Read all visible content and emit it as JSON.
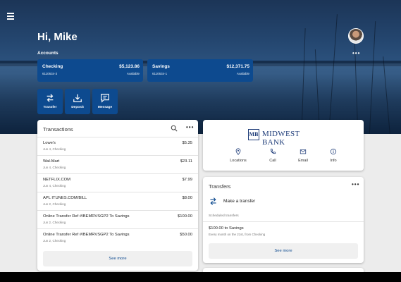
{
  "header": {
    "greeting": "Hi, Mike",
    "accounts_label": "Accounts",
    "more": "•••"
  },
  "accounts": [
    {
      "name": "Checking",
      "number": "6110634-3",
      "balance": "$5,123.86",
      "available": "Available"
    },
    {
      "name": "Savings",
      "number": "6110634-1",
      "balance": "$12,371.75",
      "available": "Available"
    }
  ],
  "quick_actions": [
    {
      "label": "Transfer",
      "icon": "transfer-icon"
    },
    {
      "label": "Deposit",
      "icon": "deposit-icon"
    },
    {
      "label": "Message",
      "icon": "message-icon"
    }
  ],
  "transactions": {
    "title": "Transactions",
    "more": "•••",
    "see_more": "See more",
    "rows": [
      {
        "name": "Lowe's",
        "sub": "Jun 4, Checking",
        "amount": "$5.35"
      },
      {
        "name": "Wal-Mart",
        "sub": "Jun 4, Checking",
        "amount": "$23.11"
      },
      {
        "name": "NETFLIX.COM",
        "sub": "Jun 4, Checking",
        "amount": "$7.99"
      },
      {
        "name": "APL ITUNES.COM/BILL",
        "sub": "Jun 2, Checking",
        "amount": "$8.00"
      },
      {
        "name": "Online Transfer Ref #IBEMRVSGP2 To Savings",
        "sub": "Jun 2, Checking",
        "amount": "$100.00"
      },
      {
        "name": "Online Transfer Ref #IBEMRVSGP2 To Savings",
        "sub": "Jun 2, Checking",
        "amount": "$50.00"
      }
    ]
  },
  "bank": {
    "logo_mark": "MB",
    "logo_text": "MIDWEST BANK",
    "actions": [
      {
        "label": "Locations",
        "icon": "location-pin-icon"
      },
      {
        "label": "Call",
        "icon": "phone-icon"
      },
      {
        "label": "Email",
        "icon": "email-icon"
      },
      {
        "label": "Info",
        "icon": "info-icon"
      }
    ]
  },
  "transfers": {
    "title": "Transfers",
    "more": "•••",
    "make_transfer": "Make a transfer",
    "scheduled_label": "Scheduled transfers",
    "scheduled": [
      {
        "title": "$100.00 to Savings",
        "sub": "Every month on the 21st, from Checking"
      }
    ],
    "see_more": "See more"
  },
  "colors": {
    "accent": "#0d4a8f",
    "brand": "#1d3b78"
  }
}
